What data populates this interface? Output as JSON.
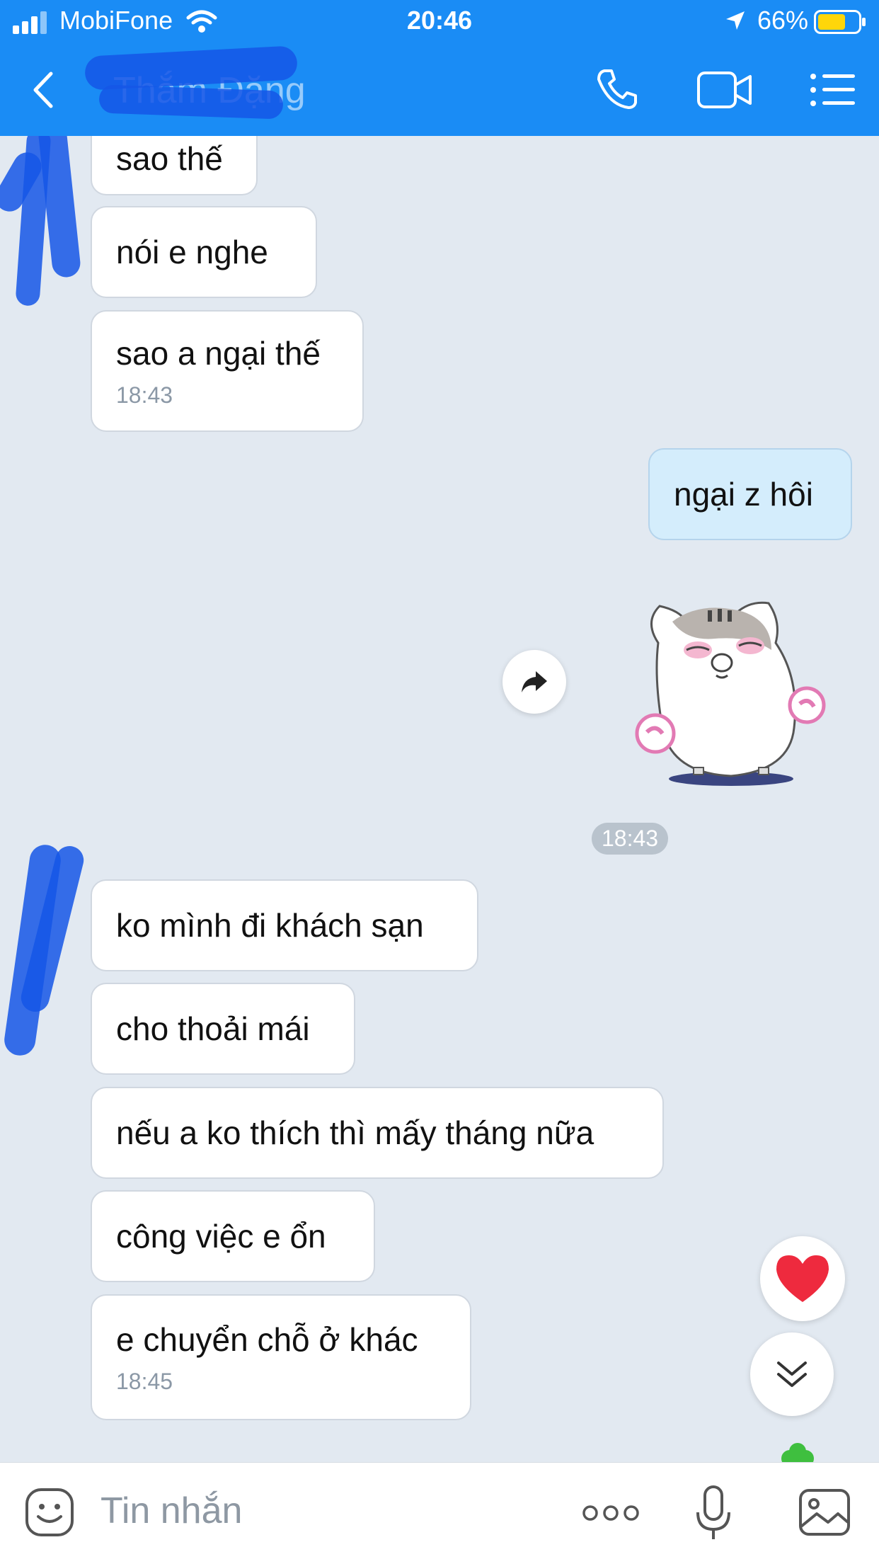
{
  "status_bar": {
    "carrier": "MobiFone",
    "time": "20:46",
    "battery_percent": "66%"
  },
  "header": {
    "title": "Thắm Đặng",
    "back_icon": "chevron-left-icon",
    "call_icon": "phone-icon",
    "video_icon": "video-camera-icon",
    "menu_icon": "list-menu-icon",
    "background_color": "#1a8cf5"
  },
  "messages": {
    "m1": {
      "text": "sao thế"
    },
    "m2": {
      "text": "nói e nghe"
    },
    "m3": {
      "text": "sao a ngại thế",
      "time": "18:43"
    },
    "m4": {
      "text": "ngại z hôi"
    },
    "sticker_time": "18:43",
    "m5": {
      "text": "ko mình đi khách sạn"
    },
    "m6": {
      "text": "cho thoải mái"
    },
    "m7": {
      "text": "nếu a ko thích thì mấy tháng nữa"
    },
    "m8": {
      "text": "công việc e ổn"
    },
    "m9": {
      "text": "e chuyển chỗ ở khác",
      "time": "18:45"
    }
  },
  "input": {
    "placeholder": "Tin nhắn",
    "emoji_icon": "emoji-icon",
    "more_icon": "more-dots-icon",
    "mic_icon": "microphone-icon",
    "image_icon": "image-icon"
  }
}
